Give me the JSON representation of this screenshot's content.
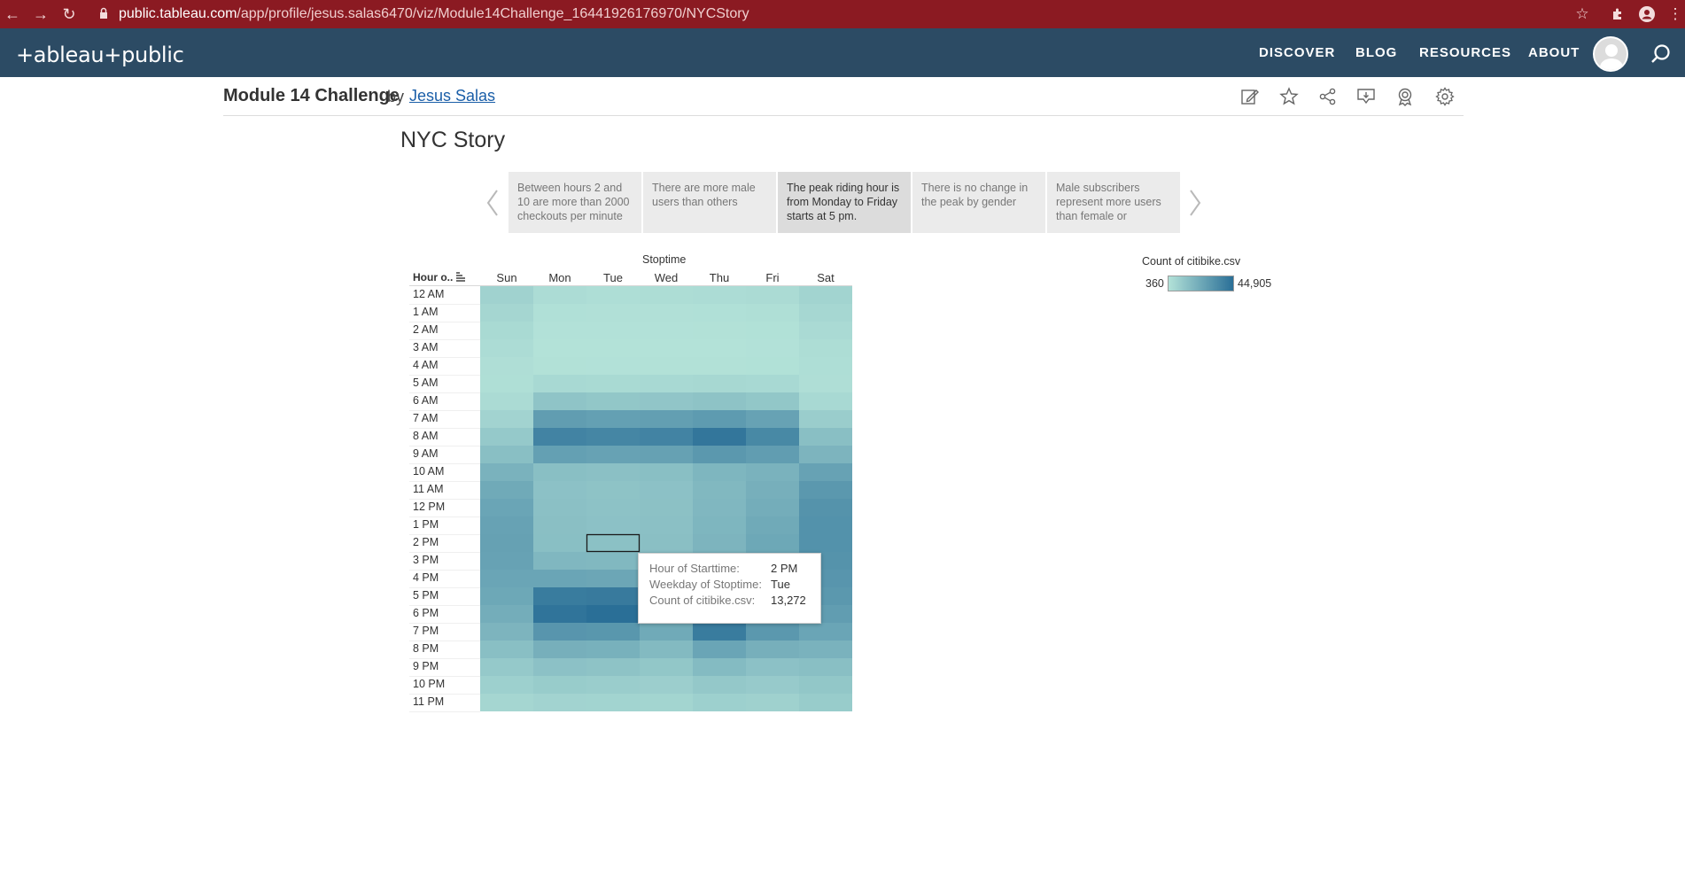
{
  "browser": {
    "url_host": "public.tableau.com",
    "url_path": "/app/profile/jesus.salas6470/viz/Module14Challenge_16441926176970/NYCStory"
  },
  "header": {
    "logo": "+ableau+public",
    "nav": [
      "DISCOVER",
      "BLOG",
      "RESOURCES",
      "ABOUT"
    ]
  },
  "viz": {
    "title": "Module 14 Challenge",
    "by": "by",
    "author": "Jesus Salas"
  },
  "story": {
    "title": "NYC Story",
    "points": [
      "Between hours 2 and 10 are more than 2000 checkouts per minute",
      "There are more male users than others",
      "The peak riding hour is from Monday to Friday starts at 5 pm.",
      "There is no change in the peak by gender",
      "Male subscribers represent more users than female or"
    ],
    "active_index": 2
  },
  "colors": {
    "header_bg": "#2c4b64",
    "browser_bg": "#8b1a22",
    "low": "#b3e2d8",
    "high": "#2a6f97"
  },
  "chart_data": {
    "type": "heatmap",
    "column_axis_title": "Stoptime",
    "row_header": "Hour o..",
    "columns": [
      "Sun",
      "Mon",
      "Tue",
      "Wed",
      "Thu",
      "Fri",
      "Sat"
    ],
    "rows": [
      "12 AM",
      "1 AM",
      "2 AM",
      "3 AM",
      "4 AM",
      "5 AM",
      "6 AM",
      "7 AM",
      "8 AM",
      "9 AM",
      "10 AM",
      "11 AM",
      "12 PM",
      "1 PM",
      "2 PM",
      "3 PM",
      "4 PM",
      "5 PM",
      "6 PM",
      "7 PM",
      "8 PM",
      "9 PM",
      "10 PM",
      "11 PM"
    ],
    "values": [
      [
        6500,
        2500,
        2000,
        2200,
        2600,
        3000,
        5800
      ],
      [
        5000,
        1200,
        1000,
        1100,
        1300,
        1500,
        4600
      ],
      [
        3500,
        700,
        600,
        650,
        750,
        900,
        3300
      ],
      [
        2500,
        500,
        400,
        450,
        500,
        600,
        2400
      ],
      [
        1800,
        800,
        700,
        750,
        800,
        900,
        1900
      ],
      [
        1500,
        4000,
        3600,
        3800,
        4200,
        4000,
        1800
      ],
      [
        3000,
        12000,
        11000,
        11500,
        12500,
        11000,
        4000
      ],
      [
        6000,
        27000,
        26000,
        26500,
        28000,
        25000,
        8500
      ],
      [
        10000,
        37000,
        36000,
        37000,
        42000,
        35000,
        14000
      ],
      [
        14000,
        26000,
        25000,
        25500,
        29000,
        27000,
        18000
      ],
      [
        19000,
        14000,
        13500,
        14000,
        17500,
        19000,
        25000
      ],
      [
        22000,
        13000,
        12500,
        13000,
        16500,
        20000,
        29000
      ],
      [
        24000,
        13500,
        12800,
        13200,
        17000,
        21000,
        31000
      ],
      [
        25000,
        13800,
        13000,
        13500,
        17500,
        22000,
        31500
      ],
      [
        25500,
        14000,
        13272,
        13800,
        18000,
        23000,
        31500
      ],
      [
        25000,
        17000,
        16500,
        17000,
        20000,
        24000,
        31000
      ],
      [
        24000,
        24000,
        23500,
        24000,
        26000,
        27000,
        30000
      ],
      [
        23000,
        40000,
        40500,
        30000,
        30000,
        32000,
        29000
      ],
      [
        21000,
        43000,
        44905,
        31000,
        32000,
        33000,
        27000
      ],
      [
        18000,
        30000,
        29500,
        22000,
        40000,
        29000,
        24000
      ],
      [
        14000,
        20000,
        19500,
        16000,
        24000,
        20000,
        19000
      ],
      [
        10000,
        13000,
        12500,
        11000,
        15500,
        13000,
        14000
      ],
      [
        7500,
        9000,
        8500,
        8000,
        10500,
        9500,
        11000
      ],
      [
        5000,
        6000,
        5800,
        5500,
        7500,
        7000,
        9000
      ]
    ],
    "color_min": 360,
    "color_max": 44905,
    "legend_title": "Count of citibike.csv",
    "legend_min_label": "360",
    "legend_max_label": "44,905",
    "selected": {
      "row": "2 PM",
      "col": "Tue"
    }
  },
  "tooltip": {
    "rows": [
      {
        "key": "Hour of Starttime:",
        "value": "2 PM"
      },
      {
        "key": "Weekday of Stoptime:",
        "value": "Tue"
      },
      {
        "key": "Count of citibike.csv:",
        "value": "13,272"
      }
    ]
  }
}
